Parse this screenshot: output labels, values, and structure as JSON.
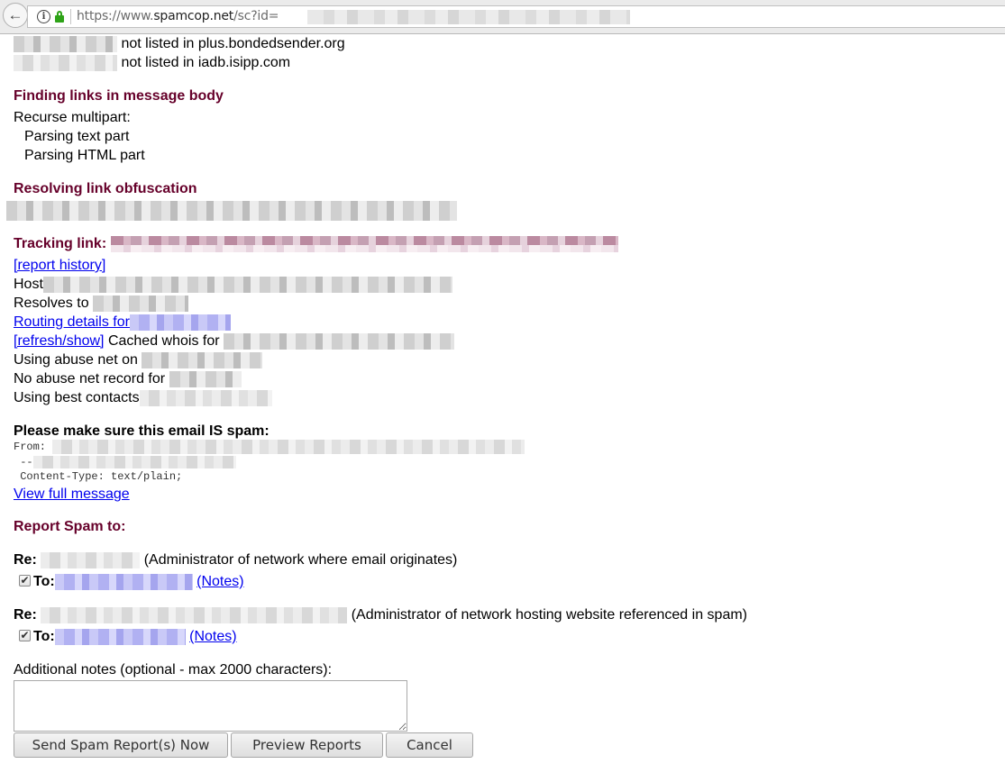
{
  "browser": {
    "url_prefix": "https://www.",
    "url_domain": "spamcop.net",
    "url_path": "/sc?id=",
    "back_icon": "←",
    "info_icon": "i"
  },
  "listing_lines": [
    {
      "text": "not listed in plus.bondedsender.org"
    },
    {
      "text": "not listed in iadb.isipp.com"
    }
  ],
  "finding_links": {
    "heading": "Finding links in message body",
    "lines": [
      "Recurse multipart:",
      "Parsing text part",
      "Parsing HTML part"
    ]
  },
  "resolving": {
    "heading": "Resolving link obfuscation"
  },
  "tracking": {
    "heading": "Tracking link:",
    "report_history": "[report history]",
    "host_label": "Host",
    "resolves_label": "Resolves to",
    "routing_label": "Routing details for",
    "refresh_link": "[refresh/show]",
    "cached_whois_label": "Cached whois for",
    "abuse_net_label": "Using abuse net on",
    "no_abuse_label": "No abuse net record for",
    "best_contacts_label": "Using best contacts"
  },
  "confirm": {
    "heading": "Please make sure this email IS spam:",
    "from_label": "From:",
    "separator": " --",
    "content_type": " Content-Type: text/plain;",
    "view_full": "View full message"
  },
  "report": {
    "heading": "Report Spam to:",
    "recipients": [
      {
        "re_label": "Re:",
        "description": "(Administrator of network where email originates)",
        "to_label": "To:",
        "notes": "(Notes)",
        "checked": true
      },
      {
        "re_label": "Re:",
        "description": "(Administrator of network hosting website referenced in spam)",
        "to_label": "To:",
        "notes": "(Notes)",
        "checked": true
      }
    ],
    "checkmark": "✔"
  },
  "notes": {
    "label": "Additional notes (optional - max 2000 characters):",
    "value": ""
  },
  "buttons": {
    "send": "Send Spam Report(s) Now",
    "preview": "Preview Reports",
    "cancel": "Cancel"
  }
}
